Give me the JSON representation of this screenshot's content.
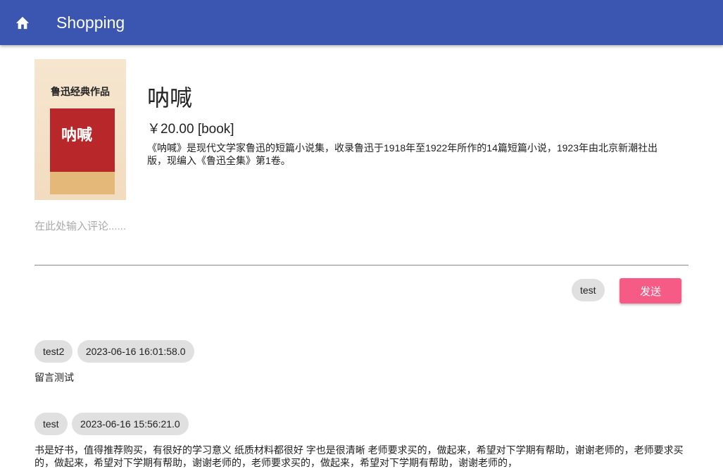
{
  "appbar": {
    "title": "Shopping",
    "icon": "home-icon"
  },
  "product": {
    "cover_text": "鲁迅经典作品",
    "cover_book_title": "呐喊",
    "name": "呐喊",
    "price": "￥20.00 [book]",
    "description": "《呐喊》是现代文学家鲁迅的短篇小说集，收录鲁迅于1918年至1922年所作的14篇短篇小说，1923年由北京新潮社出版，现编入《鲁迅全集》第1卷。"
  },
  "comment_box": {
    "placeholder": "在此处输入评论......",
    "user": "test",
    "send_label": "发送"
  },
  "comments": [
    {
      "user": "test2",
      "time": "2023-06-16 16:01:58.0",
      "text": "留言测试"
    },
    {
      "user": "test",
      "time": "2023-06-16 15:56:21.0",
      "text": "书是好书，值得推荐购买，有很好的学习意义 纸质材料都很好 字也是很清晰 老师要求买的，做起来，希望对下学期有帮助，谢谢老师的，老师要求买的，做起来，希望对下学期有帮助，谢谢老师的，老师要求买的，做起来，希望对下学期有帮助，谢谢老师的，"
    }
  ]
}
